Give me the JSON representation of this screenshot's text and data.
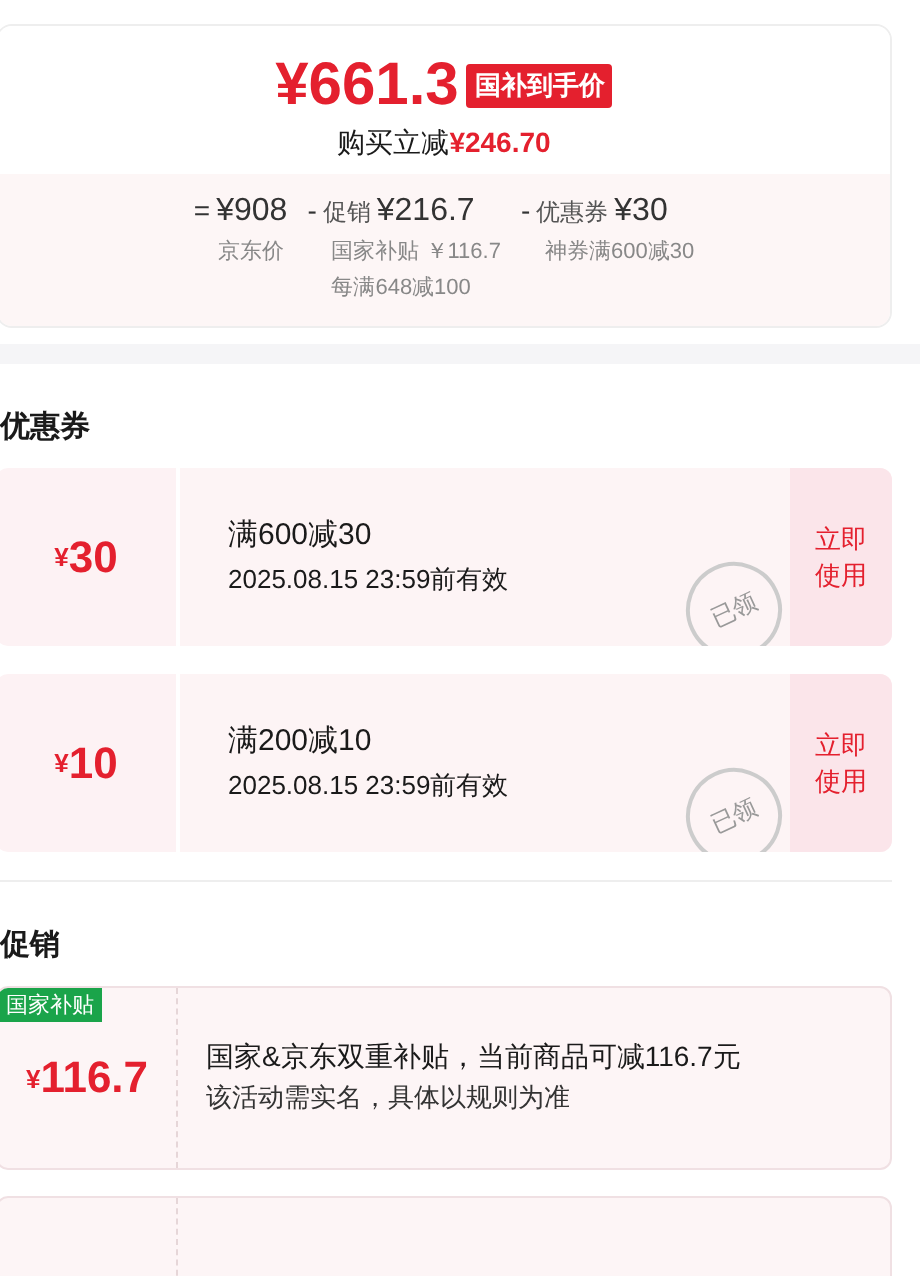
{
  "price_card": {
    "final_price": "¥661.3",
    "price_badge": "国补到手价",
    "saving_label": "购买立减",
    "saving_amount": "¥246.70",
    "breakdown": [
      {
        "operator": "=",
        "amount": "¥908",
        "notes": [
          "京东价"
        ]
      },
      {
        "operator": "-",
        "amount": "¥216.7",
        "label": "促销",
        "notes": [
          "国家补贴 ￥116.7",
          "每满648减100"
        ]
      },
      {
        "operator": "-",
        "amount": "¥30",
        "label": "优惠券",
        "notes": [
          "神券满600减30"
        ]
      }
    ]
  },
  "coupons": {
    "title": "优惠券",
    "items": [
      {
        "amount": "30",
        "currency": "¥",
        "condition": "满600减30",
        "validity": "2025.08.15 23:59前有效",
        "action": "立即使用",
        "stamp": "已领"
      },
      {
        "amount": "10",
        "currency": "¥",
        "condition": "满200减10",
        "validity": "2025.08.15 23:59前有效",
        "action": "立即使用",
        "stamp": "已领"
      }
    ]
  },
  "promotions": {
    "title": "促销",
    "items": [
      {
        "tag": "国家补贴",
        "currency": "¥",
        "amount": "116.7",
        "description": "国家&京东双重补贴，当前商品可减116.7元",
        "note": "该活动需实名，具体以规则为准"
      },
      {
        "kind": "cut"
      }
    ]
  }
}
